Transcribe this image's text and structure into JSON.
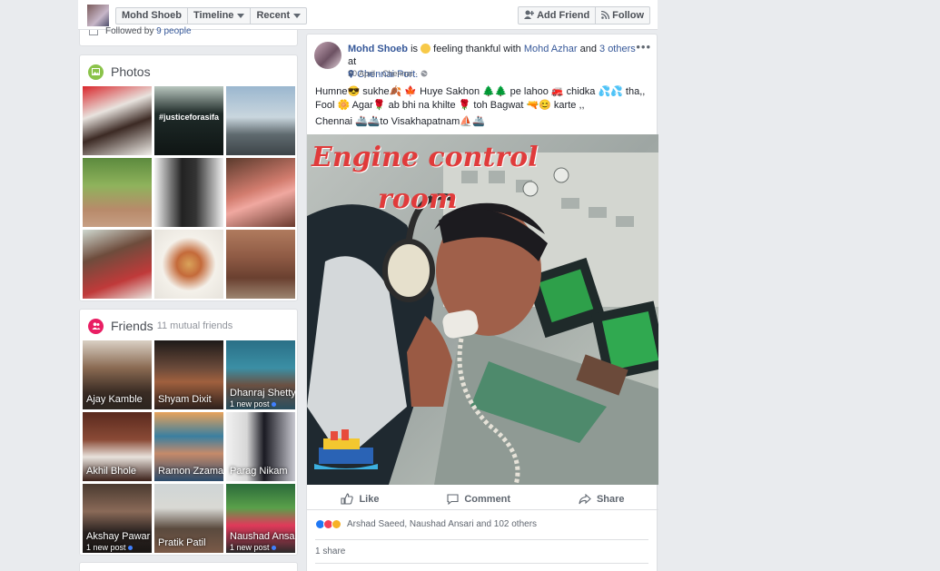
{
  "topbar": {
    "profile_name": "Mohd Shoeb",
    "timeline_label": "Timeline",
    "recent_label": "Recent",
    "add_friend_label": "Add Friend",
    "follow_label": "Follow"
  },
  "followed": {
    "prefix": "Followed by",
    "count_text": "9 people"
  },
  "photos": {
    "title": "Photos",
    "overlay_text": "#justiceforasifa"
  },
  "friends": {
    "title": "Friends",
    "mutual": "11 mutual friends",
    "list": [
      {
        "name": "Ajay Kamble",
        "new_post": ""
      },
      {
        "name": "Shyam Dixit",
        "new_post": ""
      },
      {
        "name": "Dhanraj Shetty",
        "new_post": "1 new post"
      },
      {
        "name": "Akhil Bhole",
        "new_post": ""
      },
      {
        "name": "Ramon Zzaman",
        "new_post": ""
      },
      {
        "name": "Parag Nikam",
        "new_post": ""
      },
      {
        "name": "Akshay Pawar",
        "new_post": "1 new post"
      },
      {
        "name": "Pratik Patil",
        "new_post": ""
      },
      {
        "name": "Naushad Ansari",
        "new_post": "1 new post"
      }
    ]
  },
  "post": {
    "author": "Mohd Shoeb",
    "is": "is",
    "feeling": "feeling thankful with",
    "with_name": "Mohd Azhar",
    "and": "and",
    "others": "3 others",
    "at": "at",
    "location": "Chennai Port.",
    "date": "30 April",
    "place": "Chennai",
    "line1": "Humne😎 sukhe🍂 🍁 Huye Sakhon 🌲🌲 pe lahoo 🚒 chidka 💦💦 tha,,",
    "line2": "Fool 🌼 Agar🌹 ab bhi na khilte 🌹 toh Bagwat 🔫😊 karte ,,",
    "line3": "Chennai 🚢🚢to Visakhapatnam⛵🚢",
    "photo_caption_1": "Engine control",
    "photo_caption_2": "room",
    "like": "Like",
    "comment": "Comment",
    "share": "Share",
    "reactions_text": "Arshad Saeed, Naushad Ansari and 102 others",
    "shares_text": "1 share"
  }
}
